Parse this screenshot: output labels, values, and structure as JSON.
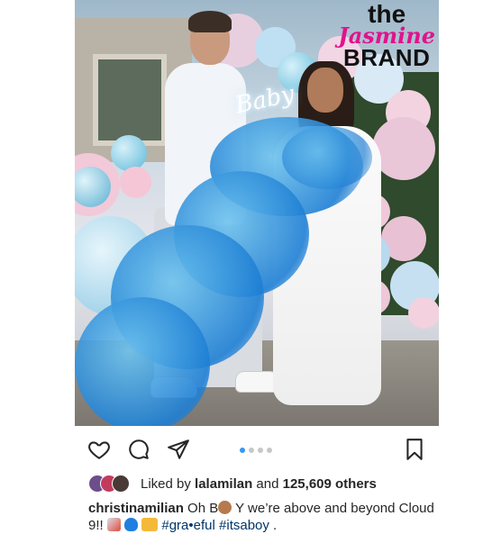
{
  "watermark": {
    "line1": "the",
    "line2": "Jasmine",
    "line3": "BRAND"
  },
  "photo": {
    "neon_sign": "Baby"
  },
  "actions": {
    "like_icon": "heart-icon",
    "comment_icon": "comment-icon",
    "share_icon": "share-icon",
    "save_icon": "bookmark-icon",
    "carousel_pages": 4,
    "carousel_active_index": 0
  },
  "likes": {
    "prefix": "Liked by ",
    "user": "lalamilan",
    "middle": " and ",
    "count": "125,609 others"
  },
  "caption": {
    "username": "christinamilian",
    "text_part1": " Oh B",
    "text_part2": "Y we’re above and beyond Cloud 9!! ",
    "hashtag1": "#gra•eful",
    "hashtag2": "#itsaboy",
    "tail": " ."
  },
  "colors": {
    "accent_blue": "#3897f0",
    "hashtag": "#003569",
    "text": "#262626",
    "watermark_pink": "#e0138c"
  }
}
